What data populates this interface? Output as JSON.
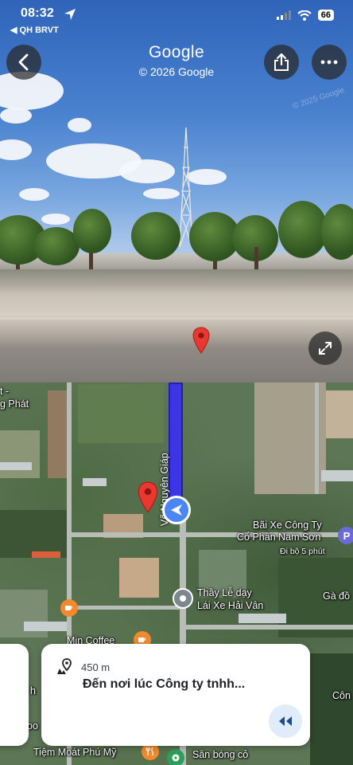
{
  "status_bar": {
    "time": "08:32",
    "back_app": "◀ QH BRVT",
    "battery": "66"
  },
  "street_view": {
    "title": "Google",
    "copyright": "© 2026 Google",
    "watermark": "© 2025 Google"
  },
  "map": {
    "street_name": "Võ Nguyên Giáp",
    "labels": {
      "top_left": "t -",
      "top_left_2": "g Phát",
      "parking_title_1": "Bãi Xe Công Ty",
      "parking_title_2": "Cổ Phần Nam Sơn",
      "parking_walk": "Đi bộ 5 phút",
      "school_1": "Thầy Lễ dạy",
      "school_2": "Lái Xe Hải Vân",
      "right_edge": "Gà đồ",
      "right_edge_2": "Côn",
      "cafe": "Min Coffee",
      "bottom_left": "Tiệm Moát Phú Mỹ",
      "bottom_right": "Sân bóng cỏ",
      "left_edge_h": "h",
      "left_edge_oo": "oo"
    },
    "parking_icon_letter": "P"
  },
  "nav_card": {
    "distance": "450 m",
    "destination": "Đến nơi lúc Công ty tnhh..."
  },
  "colors": {
    "route": "#3c35e6",
    "pin_red": "#e8382f",
    "accent_blue": "#4a86f5"
  }
}
